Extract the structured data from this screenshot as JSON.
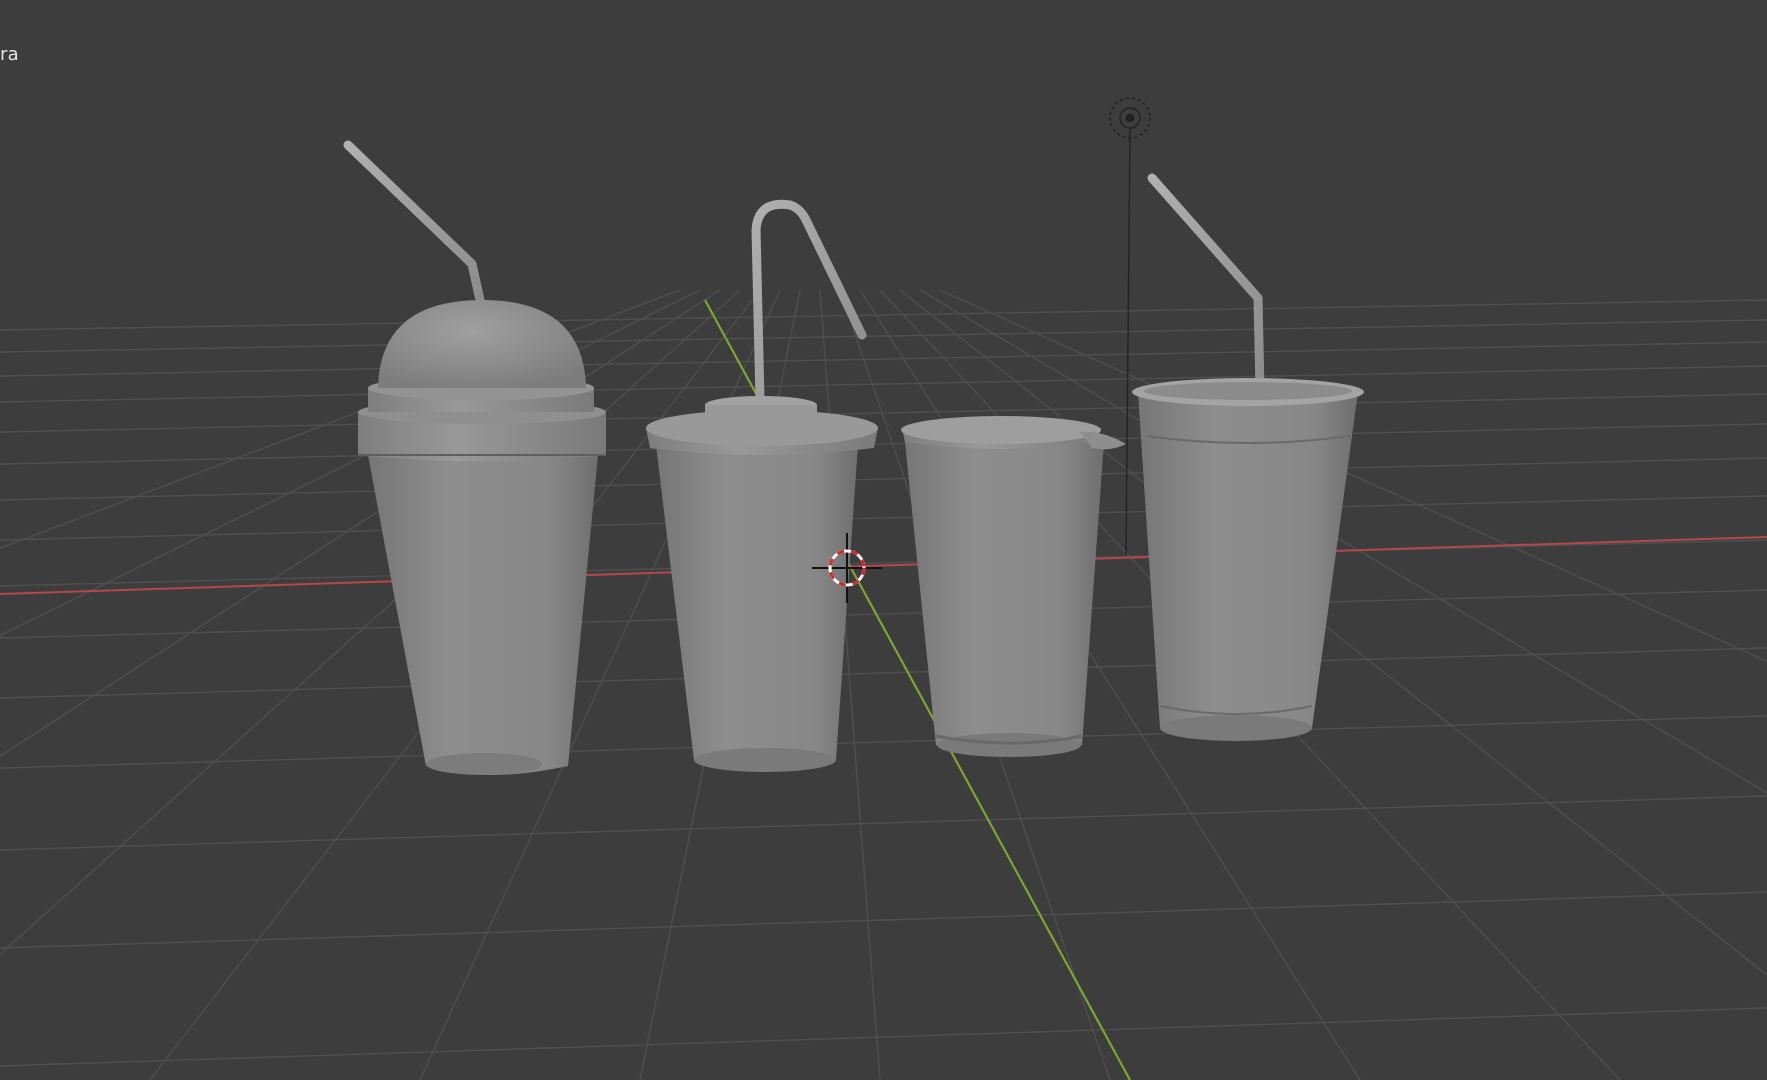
{
  "viewport": {
    "overlay_label": "ra",
    "background_color": "#3d3d3d",
    "grid_color": "#4f4f4f",
    "x_axis_color": "#b3474b",
    "y_axis_color": "#7ea52e"
  },
  "scene": {
    "objects": [
      {
        "name": "dome-lid-cup",
        "has_straw": true,
        "lid": "dome"
      },
      {
        "name": "bendy-straw-cup",
        "has_straw": true,
        "lid": "flat"
      },
      {
        "name": "lidded-cup",
        "has_straw": false,
        "lid": "sealed"
      },
      {
        "name": "straw-cup",
        "has_straw": true,
        "lid": "none"
      }
    ],
    "gizmos": [
      "3d-cursor",
      "light-source"
    ],
    "mesh_color": "#8a8a8a"
  }
}
